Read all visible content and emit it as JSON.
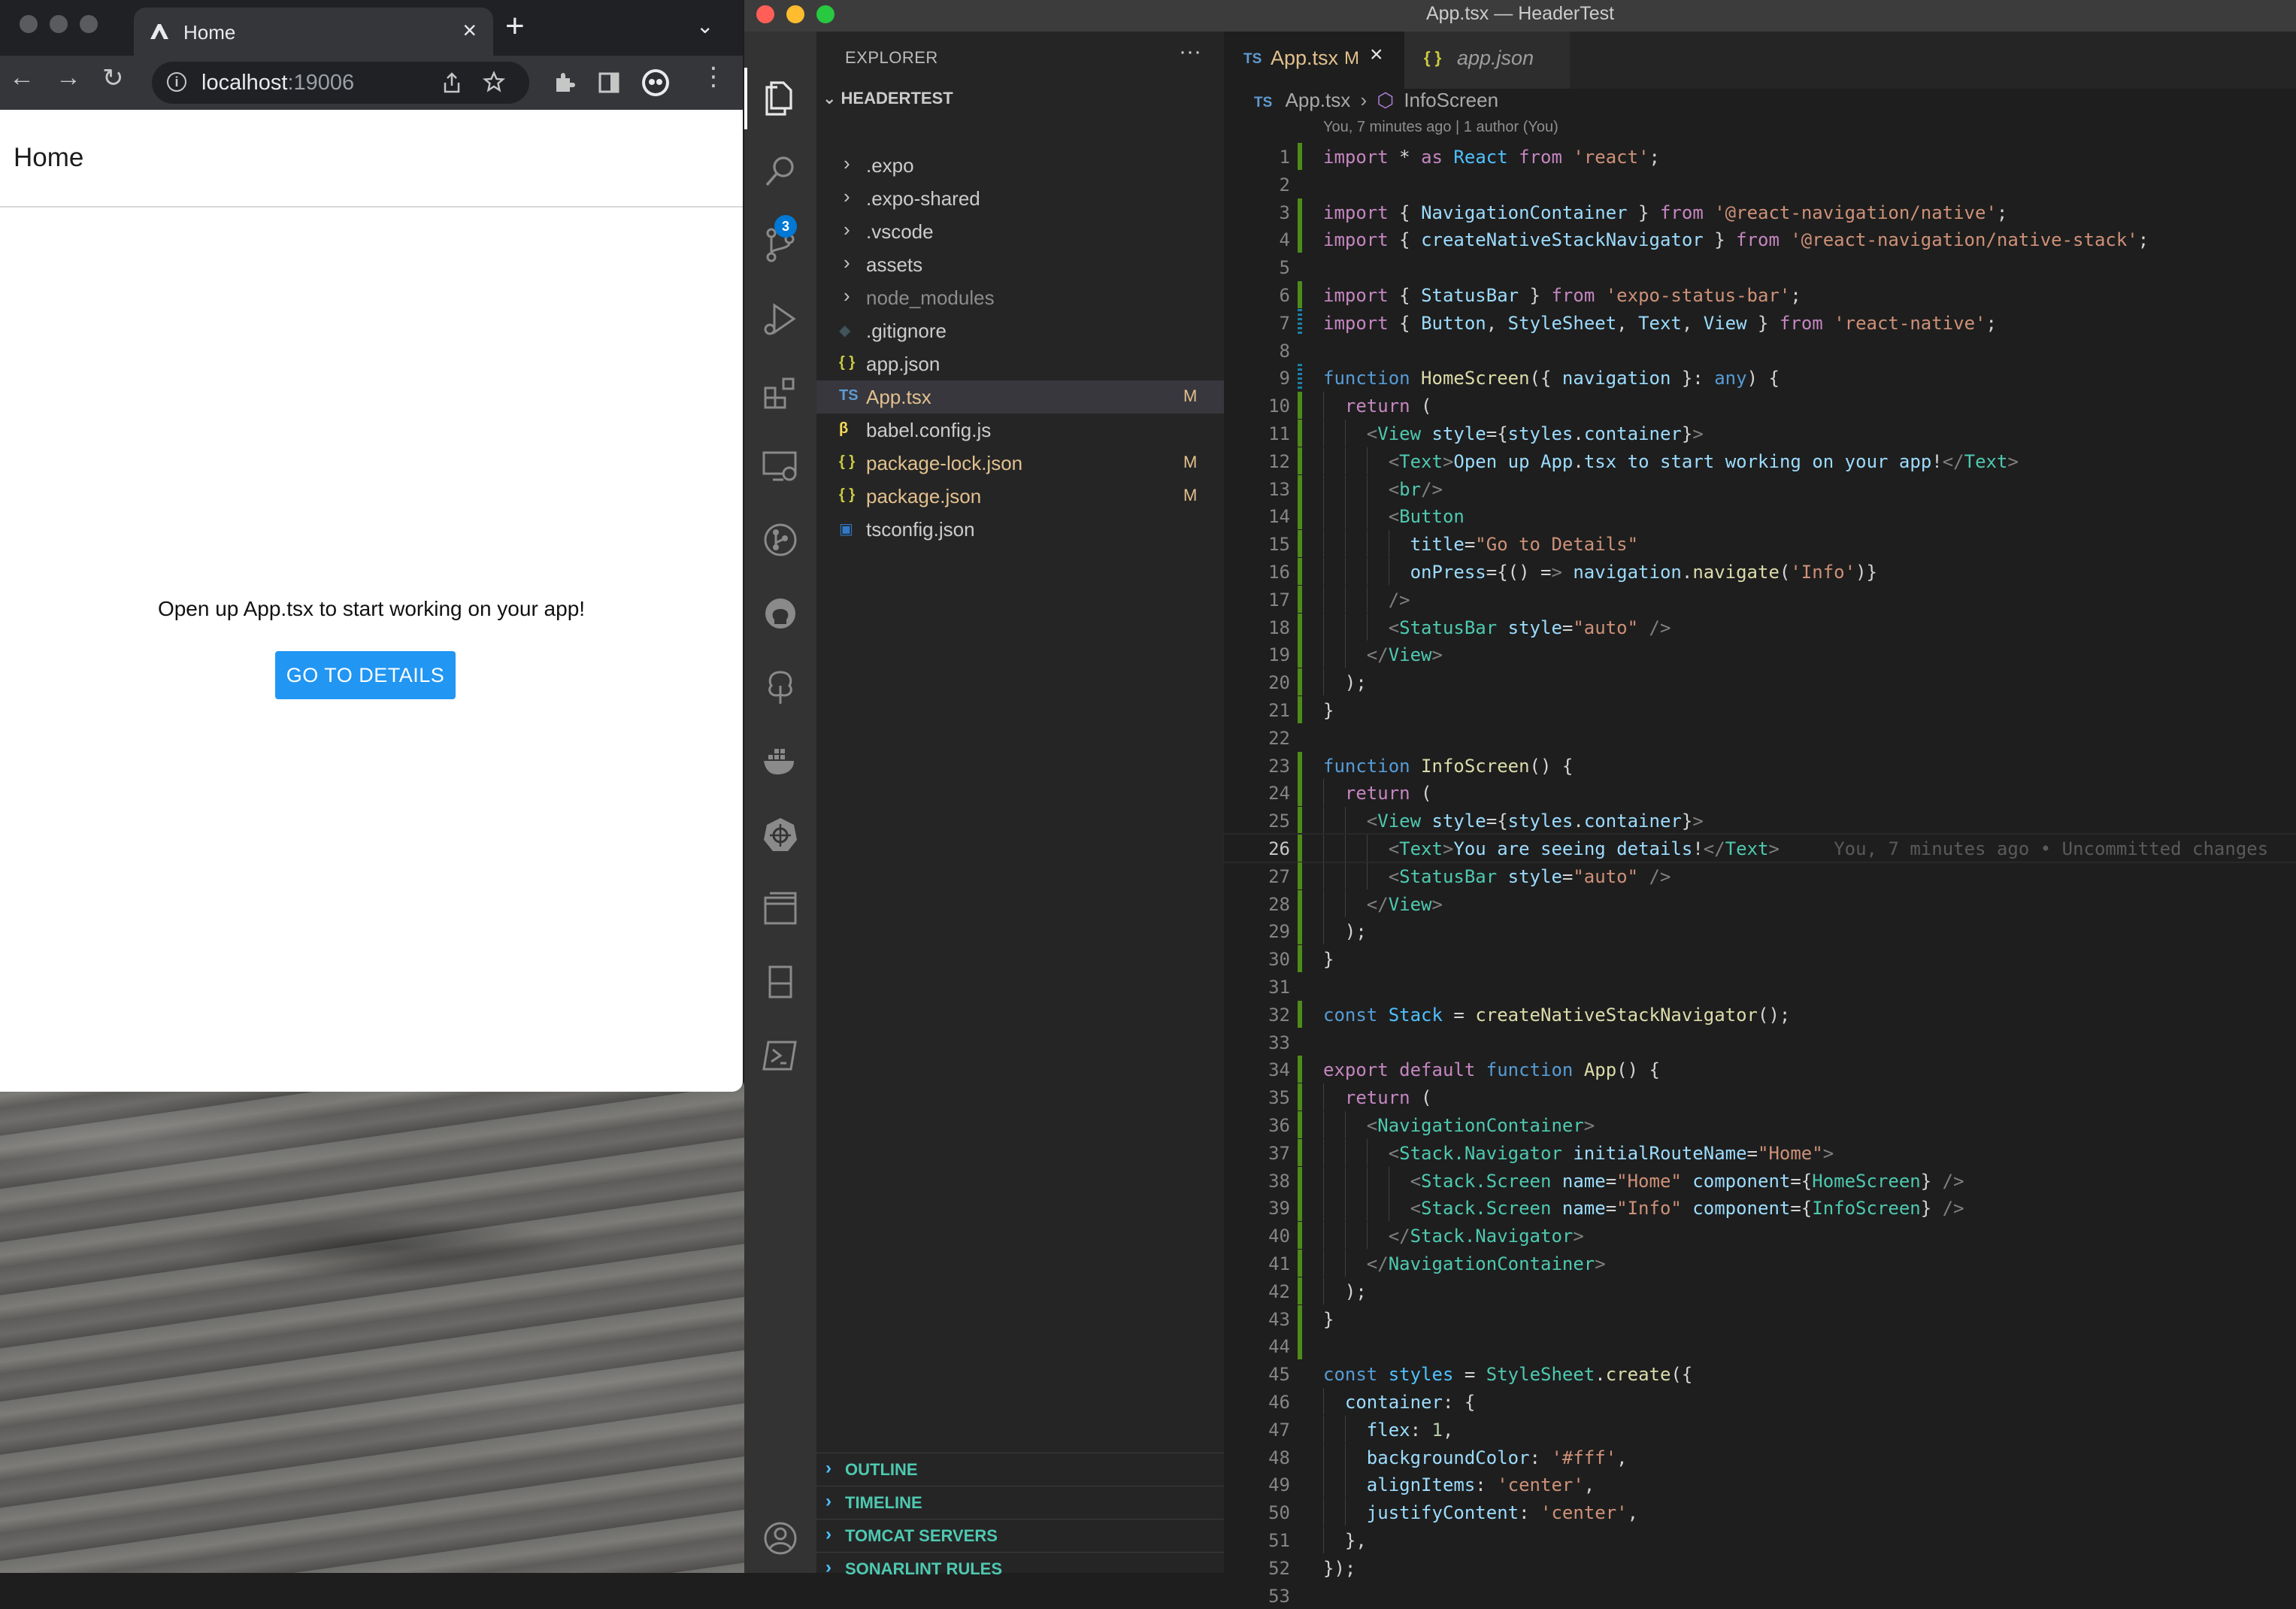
{
  "chrome": {
    "tab_title": "Home",
    "url_host": "localhost",
    "url_port": ":19006",
    "close_glyph": "×",
    "newtab_glyph": "+"
  },
  "app": {
    "header_title": "Home",
    "body_text": "Open up App.tsx to start working on your app!",
    "button_label": "GO TO DETAILS",
    "button_color": "#2196f3"
  },
  "vscode": {
    "window_title": "App.tsx — HeaderTest",
    "explorer_title": "EXPLORER",
    "project": "HEADERTEST",
    "scm_badge": "3",
    "tree": [
      {
        "label": ".expo",
        "kind": "folder",
        "status": "",
        "dim": false
      },
      {
        "label": ".expo-shared",
        "kind": "folder",
        "status": "",
        "dim": false
      },
      {
        "label": ".vscode",
        "kind": "folder",
        "status": "",
        "dim": false
      },
      {
        "label": "assets",
        "kind": "folder",
        "status": "",
        "dim": false
      },
      {
        "label": "node_modules",
        "kind": "folder",
        "status": "",
        "dim": true
      },
      {
        "label": ".gitignore",
        "kind": "git",
        "status": "",
        "dim": false
      },
      {
        "label": "app.json",
        "kind": "json",
        "status": "",
        "dim": false
      },
      {
        "label": "App.tsx",
        "kind": "ts",
        "status": "M",
        "dim": false
      },
      {
        "label": "babel.config.js",
        "kind": "babel",
        "status": "",
        "dim": false
      },
      {
        "label": "package-lock.json",
        "kind": "json",
        "status": "M",
        "dim": false
      },
      {
        "label": "package.json",
        "kind": "json",
        "status": "M",
        "dim": false
      },
      {
        "label": "tsconfig.json",
        "kind": "tsconfig",
        "status": "",
        "dim": false
      }
    ],
    "panels": [
      "OUTLINE",
      "TIMELINE",
      "TOMCAT SERVERS",
      "SONARLINT RULES"
    ],
    "tabs": [
      {
        "icon": "TS",
        "label": "App.tsx",
        "status": "M",
        "close": "×"
      },
      {
        "icon": "{ }",
        "label": "app.json",
        "status": "",
        "close": ""
      }
    ],
    "breadcrumb": {
      "file": "App.tsx",
      "sep": "›",
      "symbol": "InfoScreen",
      "file_icon": "TS"
    },
    "blame_header": "You, 7 minutes ago | 1 author (You)",
    "inline_blame": "You, 7 minutes ago • Uncommitted changes",
    "current_line": 26,
    "code": [
      "import * as React from 'react';",
      "",
      "import { NavigationContainer } from '@react-navigation/native';",
      "import { createNativeStackNavigator } from '@react-navigation/native-stack';",
      "",
      "import { StatusBar } from 'expo-status-bar';",
      "import { Button, StyleSheet, Text, View } from 'react-native';",
      "",
      "function HomeScreen({ navigation }: any) {",
      "  return (",
      "    <View style={styles.container}>",
      "      <Text>Open up App.tsx to start working on your app!</Text>",
      "      <br/>",
      "      <Button",
      "        title=\"Go to Details\"",
      "        onPress={() => navigation.navigate('Info')}",
      "      />",
      "      <StatusBar style=\"auto\" />",
      "    </View>",
      "  );",
      "}",
      "",
      "function InfoScreen() {",
      "  return (",
      "    <View style={styles.container}>",
      "      <Text>You are seeing details!</Text>",
      "      <StatusBar style=\"auto\" />",
      "    </View>",
      "  );",
      "}",
      "",
      "const Stack = createNativeStackNavigator();",
      "",
      "export default function App() {",
      "  return (",
      "    <NavigationContainer>",
      "      <Stack.Navigator initialRouteName=\"Home\">",
      "        <Stack.Screen name=\"Home\" component={HomeScreen} />",
      "        <Stack.Screen name=\"Info\" component={InfoScreen} />",
      "      </Stack.Navigator>",
      "    </NavigationContainer>",
      "  );",
      "}",
      "",
      "const styles = StyleSheet.create({",
      "  container: {",
      "    flex: 1,",
      "    backgroundColor: '#fff',",
      "    alignItems: 'center',",
      "    justifyContent: 'center',",
      "  },",
      "});",
      ""
    ],
    "gutter": {
      "added": [
        1,
        3,
        4,
        6,
        9,
        10,
        11,
        12,
        13,
        14,
        15,
        16,
        17,
        18,
        19,
        20,
        21,
        23,
        24,
        25,
        26,
        27,
        28,
        29,
        30,
        32,
        34,
        35,
        36,
        37,
        38,
        39,
        40,
        41,
        42,
        43,
        44
      ],
      "modified": [
        7,
        9
      ]
    }
  }
}
